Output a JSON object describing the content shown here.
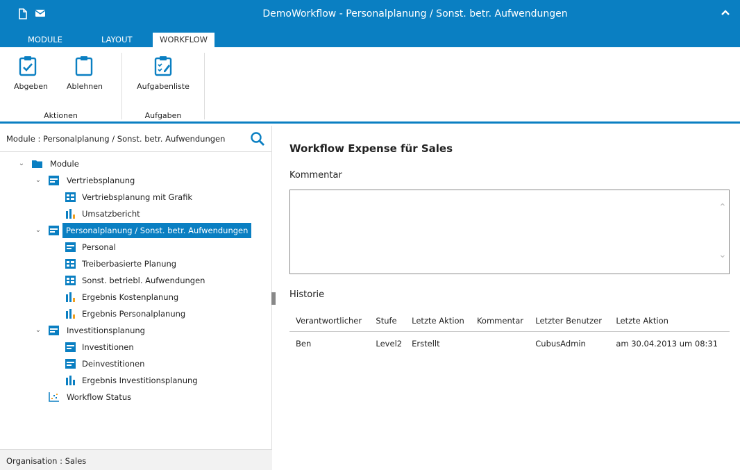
{
  "window": {
    "title": "DemoWorkflow - Personalplanung / Sonst. betr. Aufwendungen",
    "accent": "#0a7fc2"
  },
  "tabs": [
    {
      "label": "MODULE",
      "active": false
    },
    {
      "label": "LAYOUT",
      "active": false
    },
    {
      "label": "WORKFLOW",
      "active": true
    }
  ],
  "ribbon": {
    "buttons": {
      "abgeben": "Abgeben",
      "ablehnen": "Ablehnen",
      "aufgabenliste": "Aufgabenliste"
    },
    "groups": {
      "aktionen": "Aktionen",
      "aufgaben": "Aufgaben"
    }
  },
  "left": {
    "header": "Module : Personalplanung / Sonst. betr. Aufwendungen",
    "tree": {
      "root": "Module",
      "vertrieb": "Vertriebsplanung",
      "vertrieb_grafik": "Vertriebsplanung mit Grafik",
      "umsatz": "Umsatzbericht",
      "personal_sel": "Personalplanung / Sonst. betr. Aufwendungen",
      "personal": "Personal",
      "treiber": "Treiberbasierte Planung",
      "sonst": "Sonst. betriebl. Aufwendungen",
      "erg_kosten": "Ergebnis Kostenplanung",
      "erg_personal": "Ergebnis Personalplanung",
      "invest": "Investitionsplanung",
      "investitionen": "Investitionen",
      "deinvest": "Deinvestitionen",
      "erg_invest": "Ergebnis Investitionsplanung",
      "wf_status": "Workflow Status"
    },
    "footer": "Organisation : Sales"
  },
  "main": {
    "title": "Workflow Expense für Sales",
    "kommentar_label": "Kommentar",
    "kommentar_value": "",
    "historie_label": "Historie",
    "columns": [
      "Verantwortlicher",
      "Stufe",
      "Letzte Aktion",
      "Kommentar",
      "Letzter Benutzer",
      "Letzte Aktion"
    ],
    "rows": [
      [
        "Ben",
        "Level2",
        "Erstellt",
        "",
        "CubusAdmin",
        "am 30.04.2013 um 08:31"
      ]
    ]
  }
}
